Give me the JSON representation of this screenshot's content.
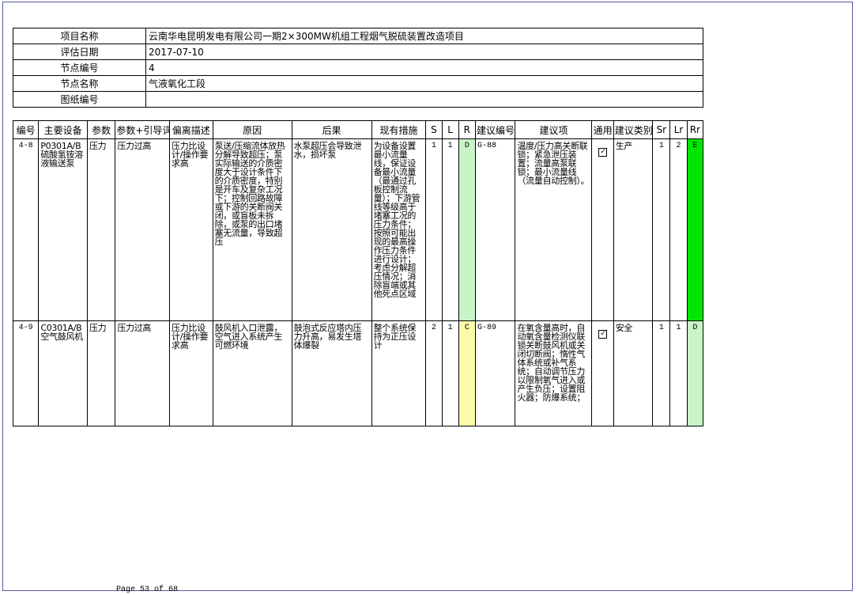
{
  "info": {
    "rows": [
      {
        "label": "项目名称",
        "value": "云南华电昆明发电有限公司一期2×300MW机组工程烟气脱硫装置改造项目"
      },
      {
        "label": "评估日期",
        "value": "2017-07-10"
      },
      {
        "label": "节点编号",
        "value": "4"
      },
      {
        "label": "节点名称",
        "value": "气液氧化工段"
      },
      {
        "label": "图纸编号",
        "value": ""
      }
    ]
  },
  "table": {
    "headers": [
      "编号",
      "主要设备",
      "参数",
      "参数+引导词",
      "偏离描述",
      "原因",
      "后果",
      "现有措施",
      "S",
      "L",
      "R",
      "建议编号",
      "建议项",
      "通用",
      "建议类别",
      "Sr",
      "Lr",
      "Rr"
    ],
    "rows": [
      {
        "id": "4-8",
        "equipment": "P0301A/B硫酸氢铵溶液输送泵",
        "param": "压力",
        "guide": "压力过高",
        "deviation": "压力比设计/操作要求高",
        "cause": "泵送/压缩流体放热分解导致超压；泵实际输送的介质密度大于设计条件下的介质密度，特别是开车及复杂工况下；控制回路故障或下游的关断阀关闭，或盲板未拆除，或泵的出口堵塞无流量，导致超压",
        "consequence": "水泵超压会导致泄水，损坏泵",
        "measures": "为设备设置最小流量线，保证设备最小流量（最通过孔板控制流量）；下游管线等级高于堵塞工况的压力条件；按照可能出现的最高操作压力条件进行设计；考虑分解超压情况；消除盲端或其他死点区域",
        "S": "1",
        "L": "1",
        "R": "D",
        "R_color": "#c8f5c8",
        "rec_no": "G-88",
        "recommendation": "温度/压力高关断联锁；紧急泄压装置；流量高泵联锁；最小流量线（流量自动控制）。",
        "general": "✓",
        "category": "生产",
        "Sr": "1",
        "Lr": "2",
        "Rr": "E",
        "Rr_color": "#00e600"
      },
      {
        "id": "4-9",
        "equipment": "C0301A/B空气鼓风机",
        "param": "压力",
        "guide": "压力过高",
        "deviation": "压力比设计/操作要求高",
        "cause": "鼓风机入口泄露，空气进入系统产生可燃环境",
        "consequence": "鼓泡式反应塔内压力升高，易发生塔体爆裂",
        "measures": "整个系统保持为正压设计",
        "S": "2",
        "L": "1",
        "R": "C",
        "R_color": "#fafaaa",
        "rec_no": "G-89",
        "recommendation": "在氧含量高时，自动氧含量检测仪联锁关断鼓风机或关闭切断阀；惰性气体系统或补气系统；自动调节压力以限制氧气进入或产生负压；设置阻火器；防爆系统；",
        "general": "✓",
        "category": "安全",
        "Sr": "1",
        "Lr": "1",
        "Rr": "D",
        "Rr_color": "#c8f5c8"
      }
    ]
  },
  "footer": "Page 53 of 68"
}
